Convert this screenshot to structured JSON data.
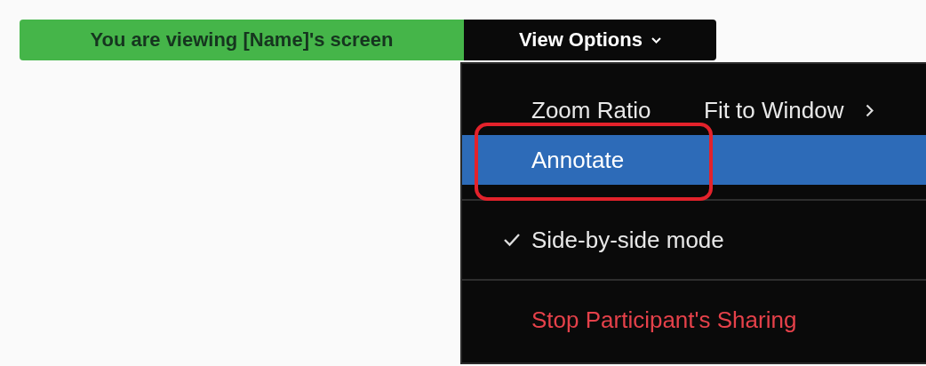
{
  "banner": {
    "status": "You are viewing [Name]'s screen",
    "button": "View Options"
  },
  "menu": {
    "items": [
      {
        "kind": "submenu",
        "label": "Zoom Ratio",
        "value": "Fit to Window",
        "selected": false,
        "outlined": false,
        "divider_before": false
      },
      {
        "kind": "action",
        "label": "Annotate",
        "selected": true,
        "outlined": true,
        "divider_before": false
      },
      {
        "kind": "toggle",
        "label": "Side-by-side mode",
        "checked": true,
        "selected": false,
        "outlined": false,
        "divider_before": true
      },
      {
        "kind": "danger",
        "label": "Stop Participant's Sharing",
        "selected": false,
        "outlined": false,
        "divider_before": true
      }
    ]
  }
}
